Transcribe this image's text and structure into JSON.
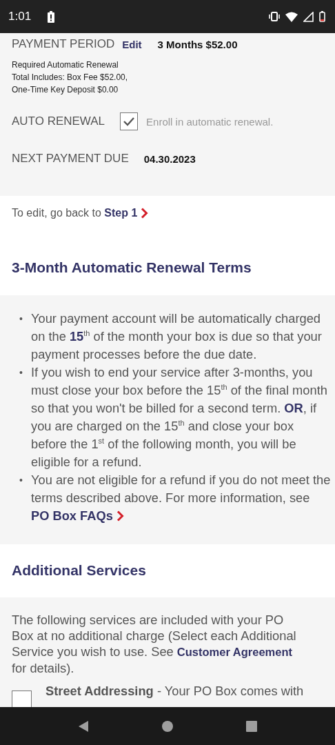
{
  "status_bar": {
    "time": "1:01"
  },
  "payment_period": {
    "label": "PAYMENT PERIOD",
    "edit_link": "Edit",
    "value": "3 Months $52.00",
    "notes": [
      "Required Automatic Renewal",
      "Total Includes: Box Fee $52.00,",
      "One-Time Key Deposit $0.00"
    ]
  },
  "auto_renewal": {
    "label": "AUTO RENEWAL",
    "checked": true,
    "checkbox_label": "Enroll in automatic renewal."
  },
  "next_payment": {
    "label": "NEXT PAYMENT DUE",
    "value": "04.30.2023"
  },
  "edit_note": {
    "text": "To edit, go back to",
    "link": "Step 1"
  },
  "terms": {
    "heading": "3-Month Automatic Renewal Terms",
    "bullets": [
      {
        "marker": "•",
        "text": "Your payment account will be automatically charged on the **15**$^{th}$ of the month your box is due so that your payment processes before the due date."
      },
      {
        "marker": "•",
        "text": "If you wish to end your service after 3-months, you must close your box before the 15$^{th}$ of the final month so that you won't be billed for a second term. **OR**, if you are charged on the 15$^{th}$ and close your box before the 1$^{st}$ of the following month, you will be eligible for a refund."
      },
      {
        "marker": "•",
        "text": "You are not eligible for a refund if you do not meet the terms described above. For more information, see",
        "link": "PO Box FAQs"
      }
    ]
  },
  "additional_services": {
    "heading": "Additional Services",
    "intro_before": "The following services are included with your PO Box at no additional charge (Select each Additional Service you wish to use. See",
    "intro_link": "Customer Agreement",
    "intro_after": "for details).",
    "services": [
      {
        "name": "Street Addressing",
        "description": "- Your PO Box comes with",
        "checked": false
      }
    ]
  }
}
